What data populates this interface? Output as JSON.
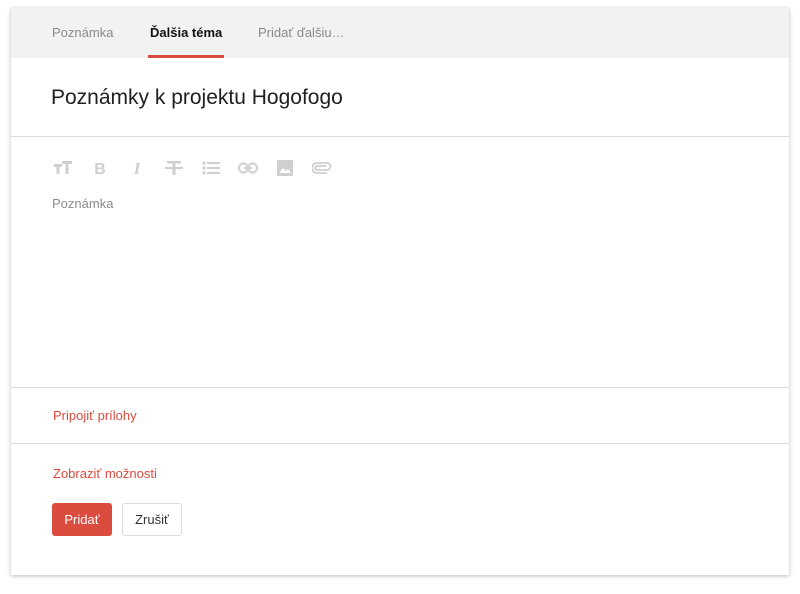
{
  "tabs": [
    {
      "label": "Poznámka",
      "active": false
    },
    {
      "label": "Ďalšia téma",
      "active": true
    },
    {
      "label": "Pridať ďalšiu…",
      "active": false
    }
  ],
  "note": {
    "title": "Poznámky k projektu Hogofogo",
    "placeholder": "Poznámka"
  },
  "toolbar": {
    "icons": [
      "text-size-icon",
      "bold-icon",
      "italic-icon",
      "strikethrough-icon",
      "bulleted-list-icon",
      "link-icon",
      "image-icon",
      "attachment-icon"
    ]
  },
  "links": {
    "attach": "Pripojiť prílohy",
    "options": "Zobraziť možnosti"
  },
  "buttons": {
    "add": "Pridať",
    "cancel": "Zrušiť"
  },
  "colors": {
    "accent": "#db4c3f",
    "tabbar_bg": "#f2f2f2",
    "toolbar_icon": "#cfcfcf"
  }
}
